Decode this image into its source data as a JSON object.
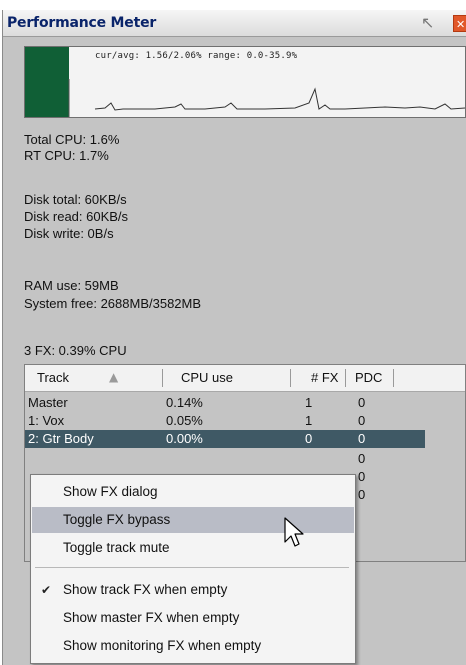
{
  "window": {
    "title": "Performance Meter",
    "pin_icon": "pin-icon",
    "close_icon": "close-icon"
  },
  "graph": {
    "label": "cur/avg: 1.56/2.06%  range: 0.0-35.9%",
    "fill_color": "#105f36"
  },
  "stats": {
    "total_cpu": "Total CPU: 1.6%",
    "rt_cpu": "RT CPU: 1.7%",
    "disk_total": "Disk total: 60KB/s",
    "disk_read": "Disk read: 60KB/s",
    "disk_write": "Disk write: 0B/s",
    "ram_use": "RAM use: 59MB",
    "system_free": "System free: 2688MB/3582MB",
    "fx_cpu": "3 FX: 0.39% CPU"
  },
  "table": {
    "columns": [
      "Track",
      "CPU use",
      "# FX",
      "PDC"
    ],
    "sort_icon": "sort-ascending-icon",
    "rows": [
      [
        "Master",
        "0.14%",
        "1",
        "0"
      ],
      [
        "1: Vox",
        "0.05%",
        "1",
        "0"
      ],
      [
        "2: Gtr Body",
        "0.00%",
        "0",
        "0"
      ],
      [
        "",
        "",
        "",
        "0"
      ],
      [
        "",
        "",
        "",
        "0"
      ],
      [
        "",
        "",
        "",
        "0"
      ]
    ],
    "selected_row_color": "#3f5965"
  },
  "context_menu": {
    "items": [
      {
        "label": "Show FX dialog"
      },
      {
        "label": "Toggle FX bypass"
      },
      {
        "label": "Toggle track mute"
      },
      {
        "label": "Show track FX when empty",
        "checked": true
      },
      {
        "label": "Show master FX when empty"
      },
      {
        "label": "Show monitoring FX when empty"
      }
    ],
    "hover_color": "#b9bcc6"
  }
}
